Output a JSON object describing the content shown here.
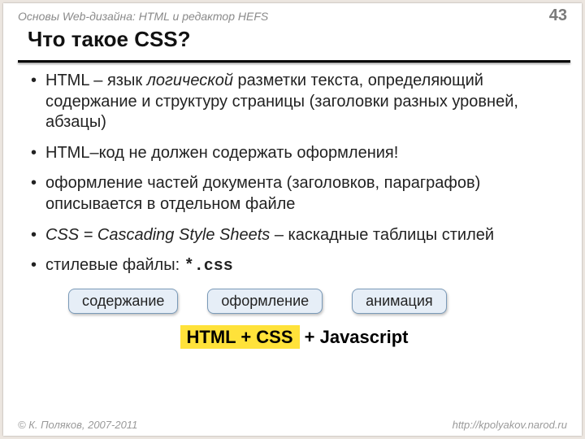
{
  "header": {
    "course": "Основы Web-дизайна: HTML и редактор HEFS",
    "page": "43"
  },
  "title": "Что такое CSS?",
  "bullets": [
    {
      "pre": "HTML – язык ",
      "it": "логической",
      "post": " разметки текста, определяющий содержание и структуру страницы (заголовки разных уровней, абзацы)"
    },
    {
      "text": "HTML–код не должен содержать оформления!"
    },
    {
      "text": "оформление частей документа (заголовков, параграфов) описывается в отдельном файле"
    },
    {
      "itpre": "CSS = Cascading Style Sheets",
      "post": " – каскадные таблицы стилей"
    },
    {
      "pre": "стилевые файлы: ",
      "mono": "*.css"
    }
  ],
  "pills": [
    "содержание",
    "оформление",
    "анимация"
  ],
  "footerline": {
    "highlight": "HTML + CSS",
    "rest": " + Javascript"
  },
  "footer": {
    "copyright": "© К. Поляков, 2007-2011",
    "url": "http://kpolyakov.narod.ru"
  }
}
